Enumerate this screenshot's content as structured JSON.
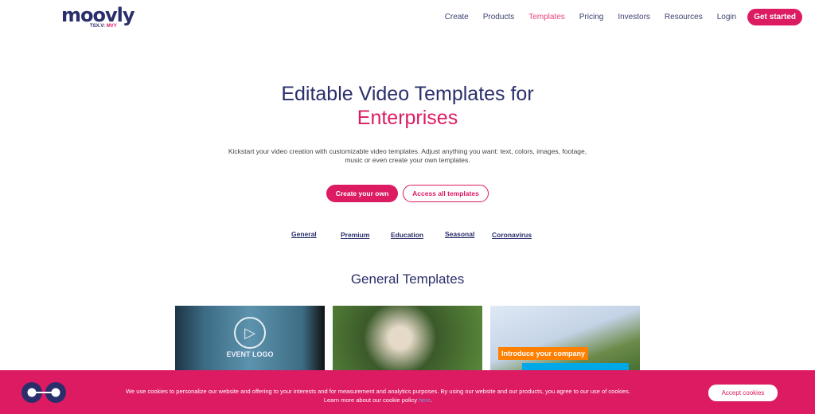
{
  "header": {
    "logo": "moovly",
    "logo_sub_prefix": "TSX.V:",
    "logo_sub_ticker": "MVY",
    "nav": [
      "Create",
      "Products",
      "Templates",
      "Pricing",
      "Investors",
      "Resources",
      "Login"
    ],
    "active": "Templates",
    "cta": "Get started"
  },
  "hero": {
    "title_line1": "Editable Video Templates for",
    "title_line2": "Enterprises",
    "lead": "Kickstart your video creation with customizable video templates. Adjust anything you want: text, colors, images, footage, music or even create your own templates.",
    "primary_button": "Create your own",
    "secondary_button": "Access all templates"
  },
  "categories": [
    "General",
    "Premium",
    "Education",
    "Seasonal",
    "Coronavirus"
  ],
  "section_title": "General Templates",
  "cards": [
    {
      "overlay": "EVENT LOGO"
    },
    {
      "overlay": ""
    },
    {
      "overlay": "Introduce your company"
    }
  ],
  "cookie": {
    "text": "We use cookies to personalize our website and offering to your interests and for measurement and analytics purposes. By using our website and our products, you agree to our use of cookies.",
    "text2": "Learn more about our cookie policy ",
    "link": "here",
    "period": ".",
    "accept": "Accept cookies"
  },
  "colors": {
    "brand_pink": "#dc1b63",
    "navy": "#2a2f6b"
  }
}
